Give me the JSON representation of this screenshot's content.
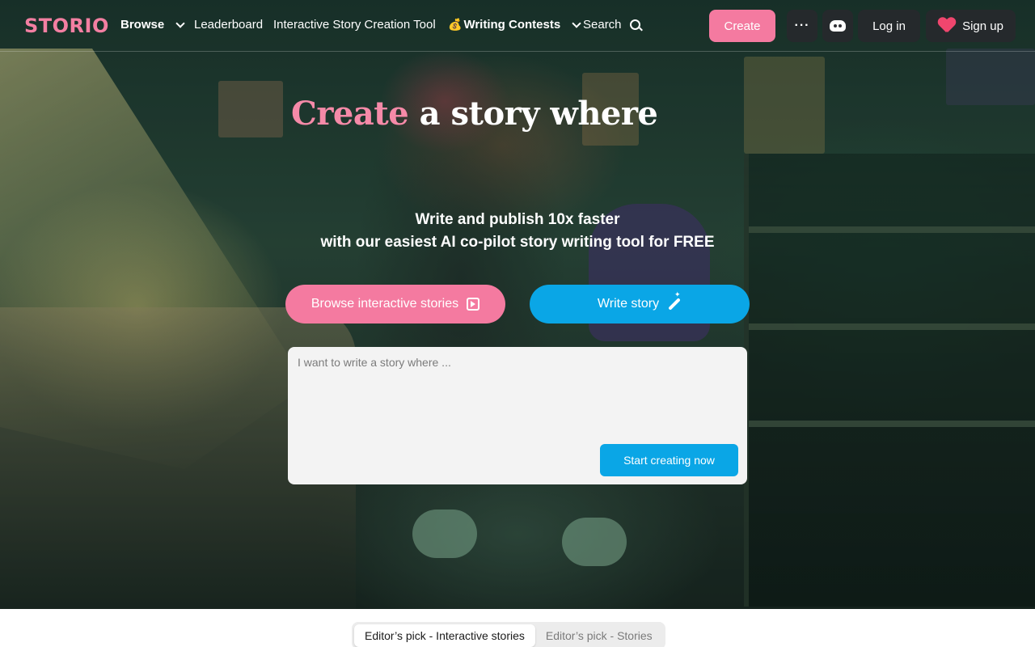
{
  "brand": {
    "logo": "STORIO",
    "accent_color": "#f47aa0",
    "secondary_color": "#0aa6e6"
  },
  "nav": {
    "browse": "Browse",
    "leaderboard": "Leaderboard",
    "story_tool": "Interactive Story Creation Tool",
    "contests_emoji": "💰",
    "contests": "Writing Contests",
    "search": "Search",
    "create": "Create",
    "more": "···",
    "login": "Log in",
    "signup": "Sign up"
  },
  "hero": {
    "headline_accent": "Create",
    "headline_rest": " a story where",
    "subline_1": "Write and publish 10x faster",
    "subline_2": "with our easiest AI co-pilot story writing tool for FREE",
    "browse_button": "Browse interactive stories",
    "write_button": "Write story",
    "prompt_placeholder": "I want to write a story where ...",
    "start_button": "Start creating now"
  },
  "tabs": [
    {
      "label": "Editor’s pick - Interactive stories",
      "active": true
    },
    {
      "label": "Editor’s pick - Stories",
      "active": false
    }
  ]
}
